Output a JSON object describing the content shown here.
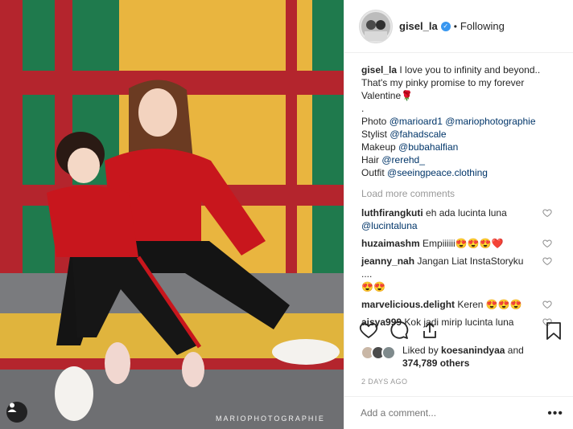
{
  "post": {
    "username": "gisel_la",
    "follow_status": "Following",
    "separator": "•",
    "watermark": "MARIOPHOTOGRAPHIE",
    "caption": {
      "username": "gisel_la",
      "line1": "I love you to infinity and beyond..",
      "line2": "That's my pinky promise to my forever",
      "line3": "Valentine🌹",
      "line4": ".",
      "photo_label": "Photo",
      "photo_mention1": "@marioard1",
      "photo_mention2": "@mariophotographie",
      "stylist_label": "Stylist",
      "stylist_mention": "@fahadscale",
      "makeup_label": "Makeup",
      "makeup_mention": "@bubahalfian",
      "hair_label": "Hair",
      "hair_mention": "@rerehd_",
      "outfit_label": "Outfit",
      "outfit_mention": "@seeingpeace.clothing"
    },
    "load_more": "Load more comments",
    "comments": [
      {
        "username": "luthfirangkuti",
        "text": "eh ada lucinta luna",
        "line2": "@lucintaluna"
      },
      {
        "username": "huzaimashm",
        "text": "Empiiiiii😍😍😍❤️"
      },
      {
        "username": "jeanny_nah",
        "text": "Jangan Liat InstaStoryku ....",
        "line2": "😍😍"
      },
      {
        "username": "marvelicious.delight",
        "text": "Keren 😍😍😍"
      },
      {
        "username": "aisya999",
        "text": "Kok jadi mirip lucinta luna"
      }
    ],
    "likes": {
      "prefix": "Liked by",
      "user": "koesanindyaa",
      "joiner": "and",
      "count": "374,789 others"
    },
    "timestamp": "2 DAYS AGO",
    "add_comment_placeholder": "Add a comment...",
    "more_label": "•••",
    "icons": {
      "like": "heart-icon",
      "comment": "comment-bubble-icon",
      "share": "share-icon",
      "save": "bookmark-icon",
      "verified": "verified-badge-icon",
      "tag": "user-tag-icon"
    },
    "colors": {
      "link": "#003569",
      "verified": "#3897f0",
      "muted": "#999999",
      "text": "#262626"
    }
  }
}
